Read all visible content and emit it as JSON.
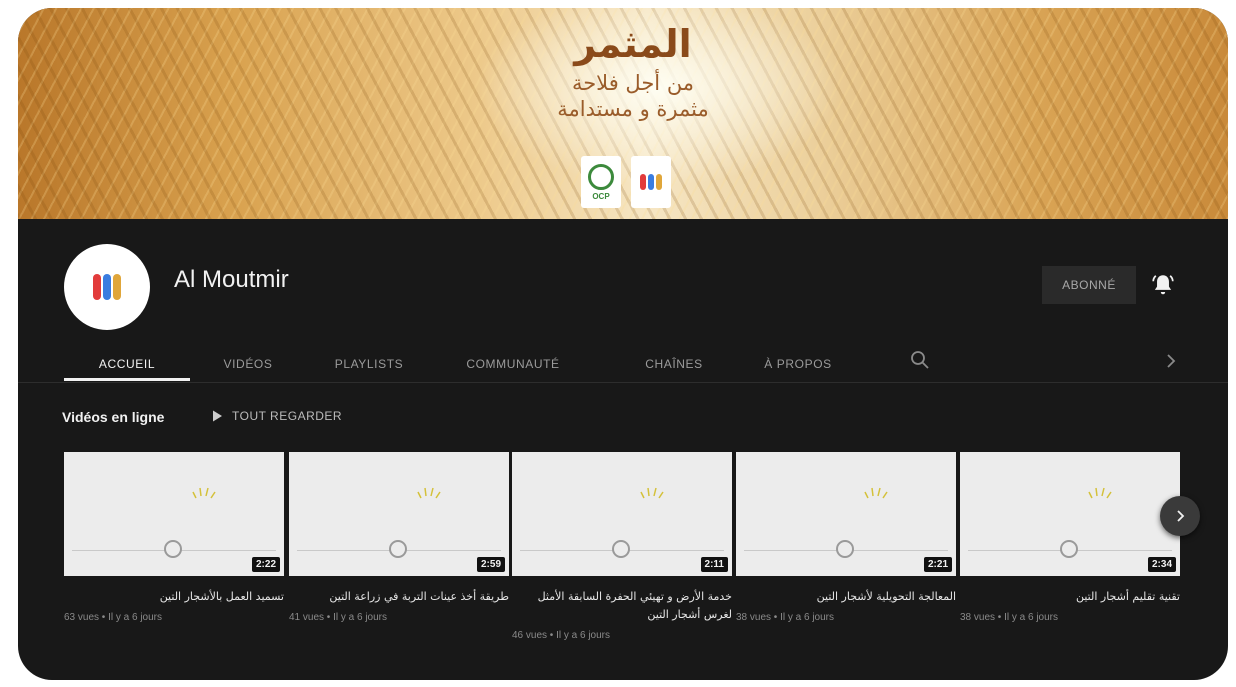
{
  "banner": {
    "title_ar": "المثمر",
    "line1_ar": "من أجل فلاحة",
    "line2_ar": "مثمرة و مستدامة",
    "ocp_label": "OCP"
  },
  "channel": {
    "name": "Al Moutmir",
    "subscribe_label": "ABONNÉ"
  },
  "tabs": [
    {
      "label": "ACCUEIL",
      "active": true
    },
    {
      "label": "VIDÉOS"
    },
    {
      "label": "PLAYLISTS"
    },
    {
      "label": "COMMUNAUTÉ"
    },
    {
      "label": "CHAÎNES"
    },
    {
      "label": "À PROPOS"
    }
  ],
  "shelf": {
    "title": "Vidéos en ligne",
    "play_all_label": "TOUT REGARDER"
  },
  "videos": [
    {
      "title": "تسميد العمل بالأشجار التين",
      "duration": "2:22",
      "meta": "63 vues • Il y a 6 jours"
    },
    {
      "title": "طريقة أخذ عينات التربة في زراعة التين",
      "duration": "2:59",
      "meta": "41 vues • Il y a 6 jours"
    },
    {
      "title": "خدمة الأرض و تهيئي الحفرة السابقة الأمثل لغرس أشجار التين",
      "duration": "2:11",
      "meta": "46 vues • Il y a 6 jours"
    },
    {
      "title": "المعالجة التحويلية لأشجار التين",
      "duration": "2:21",
      "meta": "38 vues • Il y a 6 jours"
    },
    {
      "title": "تقنية تقليم أشجار التين",
      "duration": "2:34",
      "meta": "38 vues • Il y a 6 jours"
    }
  ],
  "colors": {
    "background": "#181818",
    "text_primary": "#f1f1f1",
    "text_secondary": "#8a8a8a",
    "thumb_brand": "#8b4a8a"
  },
  "icons": [
    "bell-icon",
    "search-icon",
    "chevron-right-icon",
    "play-icon"
  ]
}
